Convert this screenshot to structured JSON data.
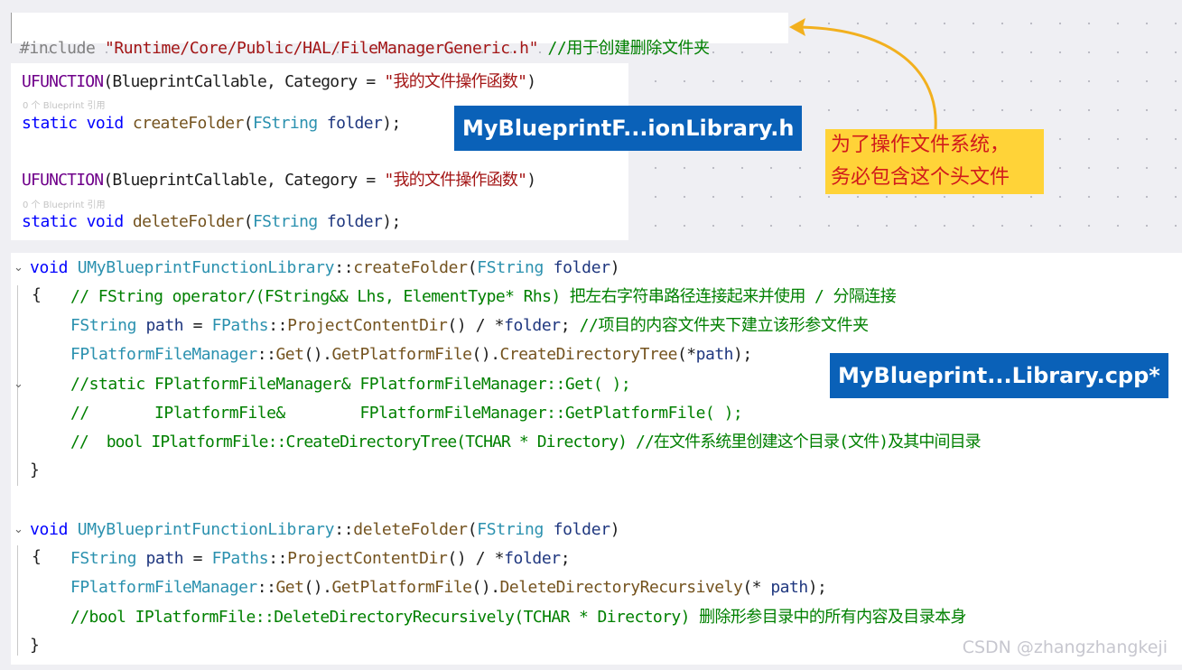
{
  "include_line": {
    "directive": "#include ",
    "path": "\"Runtime/Core/Public/HAL/FileManagerGeneric.h\"",
    "comment": " //用于创建删除文件夹"
  },
  "header_panel": {
    "title": "MyBlueprintF...ionLibrary.h",
    "lines": [
      {
        "macro": "UFUNCTION",
        "open": "(BlueprintCallable, Category = ",
        "string": "\"我的文件操作函数\"",
        "close": ")"
      },
      {
        "ref": "0 个 Blueprint 引用"
      },
      {
        "kw": "static void ",
        "fn": "createFolder",
        "open": "(",
        "type": "FString",
        "param": " folder",
        "close": ");"
      },
      {
        "macro": "UFUNCTION",
        "open": "(BlueprintCallable, Category = ",
        "string": "\"我的文件操作函数\"",
        "close": ")"
      },
      {
        "ref": "0 个 Blueprint 引用"
      },
      {
        "kw": "static void ",
        "fn": "deleteFolder",
        "open": "(",
        "type": "FString",
        "param": " folder",
        "close": ");"
      }
    ]
  },
  "annotation": {
    "lines": [
      "为了操作文件系统，",
      "务必包含这个头文件"
    ],
    "arrow_color": "#f2b01e"
  },
  "cpp_panel": {
    "title": "MyBlueprint...Library.cpp*",
    "create": {
      "sig_kw": "void ",
      "sig_class": "UMyBlueprintFunctionLibrary",
      "sig_sep": "::",
      "sig_fn": "createFolder",
      "sig_open": "(",
      "sig_type": "FString",
      "sig_param": " folder",
      "sig_close": ")",
      "brace_open": "{",
      "brace_close": "}",
      "c1": "// FString operator/(FString&& Lhs, ElementType* Rhs) 把左右字符串路径连接起来并使用 / 分隔连接",
      "l2_type": "FString",
      "l2_var": " path",
      "l2_eq": " = ",
      "l2_cls": "FPaths",
      "l2_sep": "::",
      "l2_fn": "ProjectContentDir",
      "l2_rest": "() / *",
      "l2_param": "folder",
      "l2_semi": ";",
      "l2_comment": " //项目的内容文件夹下建立该形参文件夹",
      "l3_cls": "FPlatformFileManager",
      "l3_sep": "::",
      "l3_get": "Get",
      "l3_dot1": "().",
      "l3_gpf": "GetPlatformFile",
      "l3_dot2": "().",
      "l3_fn": "CreateDirectoryTree",
      "l3_open": "(*",
      "l3_var": "path",
      "l3_close": ");",
      "c4": "//static FPlatformFileManager& FPlatformFileManager::Get( );",
      "c5": "//       IPlatformFile&        FPlatformFileManager::GetPlatformFile( );",
      "c6": "//  bool IPlatformFile::CreateDirectoryTree(TCHAR * Directory) //在文件系统里创建这个目录(文件)及其中间目录"
    },
    "delete": {
      "sig_kw": "void ",
      "sig_class": "UMyBlueprintFunctionLibrary",
      "sig_sep": "::",
      "sig_fn": "deleteFolder",
      "sig_open": "(",
      "sig_type": "FString",
      "sig_param": " folder",
      "sig_close": ")",
      "brace_open": "{",
      "brace_close": "}",
      "l1_type": "FString",
      "l1_var": " path",
      "l1_eq": " = ",
      "l1_cls": "FPaths",
      "l1_sep": "::",
      "l1_fn": "ProjectContentDir",
      "l1_rest": "() / *",
      "l1_param": "folder",
      "l1_semi": ";",
      "l2_cls": "FPlatformFileManager",
      "l2_sep": "::",
      "l2_get": "Get",
      "l2_dot1": "().",
      "l2_gpf": "GetPlatformFile",
      "l2_dot2": "().",
      "l2_fn": "DeleteDirectoryRecursively",
      "l2_open": "(* ",
      "l2_var": "path",
      "l2_close": ");",
      "c3": "//bool IPlatformFile::DeleteDirectoryRecursively(TCHAR * Directory) 删除形参目录中的所有内容及目录本身"
    }
  },
  "watermark": "CSDN @zhangzhangkeji"
}
